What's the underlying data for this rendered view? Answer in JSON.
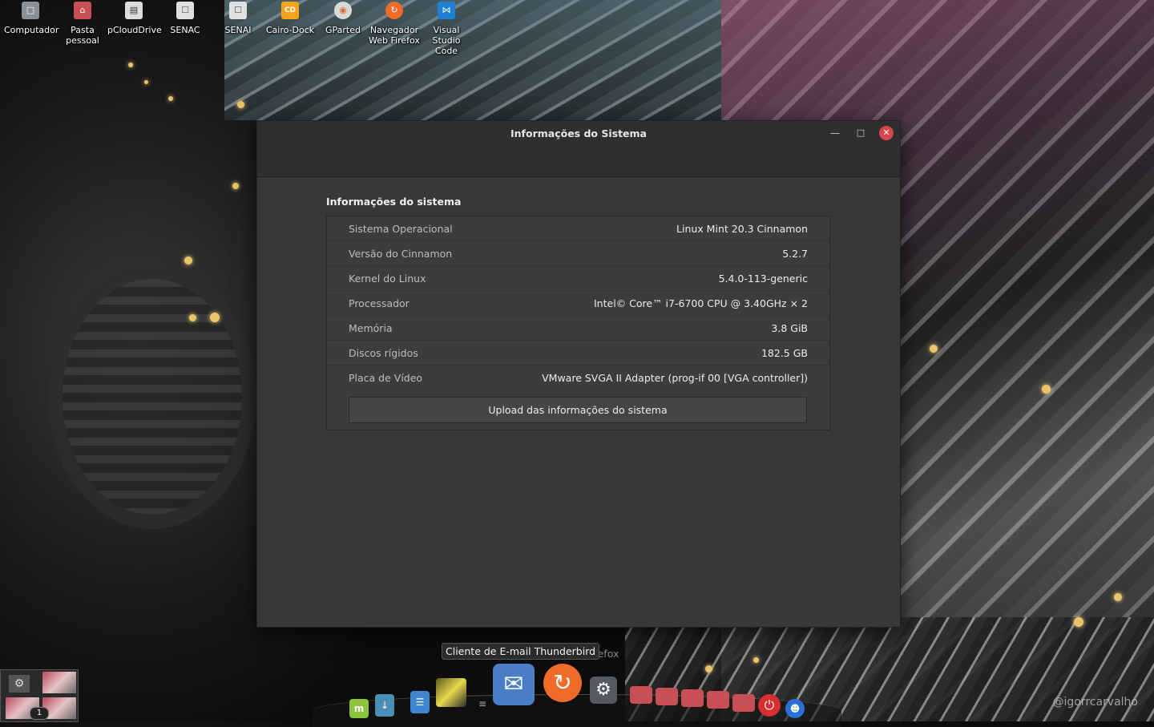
{
  "desktop": {
    "icons": [
      {
        "label": "Computador",
        "icon": "monitor-icon",
        "color": "#8a8f99"
      },
      {
        "label": "Pasta pessoal",
        "icon": "home-folder-icon",
        "color": "#c94f55"
      },
      {
        "label": "pCloudDrive",
        "icon": "drive-icon",
        "color": "#dcdcdc"
      },
      {
        "label": "SENAC",
        "icon": "file-icon",
        "color": "#e0e0e0"
      },
      {
        "label": "SENAI",
        "icon": "file-icon",
        "color": "#e0e0e0"
      },
      {
        "label": "Cairo-Dock",
        "icon": "cairo-dock-icon",
        "color": "#f3a41a",
        "glyph": "CD"
      },
      {
        "label": "GParted",
        "icon": "gparted-icon",
        "color": "#d9d9d9"
      },
      {
        "label": "Navegador Web Firefox",
        "icon": "firefox-icon",
        "color": "#f06a28"
      },
      {
        "label": "Visual Studio Code",
        "icon": "vscode-icon",
        "color": "#1e7fd6"
      }
    ],
    "watermark": "@igorrcarvalho"
  },
  "window": {
    "title": "Informações do Sistema",
    "section_title": "Informações do sistema",
    "rows": [
      {
        "key": "Sistema Operacional",
        "value": "Linux Mint 20.3 Cinnamon"
      },
      {
        "key": "Versão do Cinnamon",
        "value": "5.2.7"
      },
      {
        "key": "Kernel do Linux",
        "value": "5.4.0-113-generic"
      },
      {
        "key": "Processador",
        "value": "Intel© Core™ i7-6700 CPU @ 3.40GHz × 2"
      },
      {
        "key": "Memória",
        "value": "3.8 GiB"
      },
      {
        "key": "Discos rígidos",
        "value": "182.5 GB"
      },
      {
        "key": "Placa de Vídeo",
        "value": "VMware SVGA II Adapter (prog-if 00 [VGA controller])"
      }
    ],
    "upload_label": "Upload das informações do sistema"
  },
  "dock": {
    "tooltip": "Cliente de E-mail Thunderbird",
    "ghost_label": "Firefox"
  },
  "workspace": {
    "count_badge": "1"
  }
}
